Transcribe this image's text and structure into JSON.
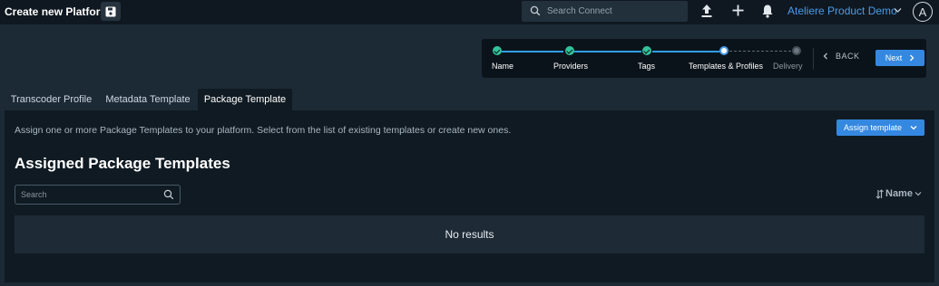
{
  "topbar": {
    "title": "Create new Platform",
    "search_placeholder": "Search Connect",
    "user_name": "Ateliere Product Demo",
    "avatar_initial": "A"
  },
  "stepper": {
    "steps": [
      {
        "label": "Name",
        "state": "done"
      },
      {
        "label": "Providers",
        "state": "done"
      },
      {
        "label": "Tags",
        "state": "done"
      },
      {
        "label": "Templates & Profiles",
        "state": "current"
      },
      {
        "label": "Delivery",
        "state": "pending"
      }
    ],
    "back_label": "BACK",
    "next_label": "Next"
  },
  "tabs": [
    {
      "label": "Transcoder Profile",
      "active": false
    },
    {
      "label": "Metadata Template",
      "active": false
    },
    {
      "label": "Package Template",
      "active": true
    }
  ],
  "main": {
    "description": "Assign one or more Package Templates to your platform. Select from the list of existing templates or create new ones.",
    "assign_button": "Assign template",
    "section_title": "Assigned Package Templates",
    "search_placeholder": "Search",
    "sort_label": "Name",
    "empty_text": "No results"
  },
  "colors": {
    "accent": "#3588e0",
    "done": "#35c29a",
    "background": "#1c2a36",
    "panel": "#0f1a22"
  },
  "icons": [
    "save-icon",
    "search-icon",
    "upload-icon",
    "plus-icon",
    "bell-icon",
    "chevron-down-icon",
    "chevron-left-icon",
    "chevron-right-icon",
    "sort-icon"
  ]
}
